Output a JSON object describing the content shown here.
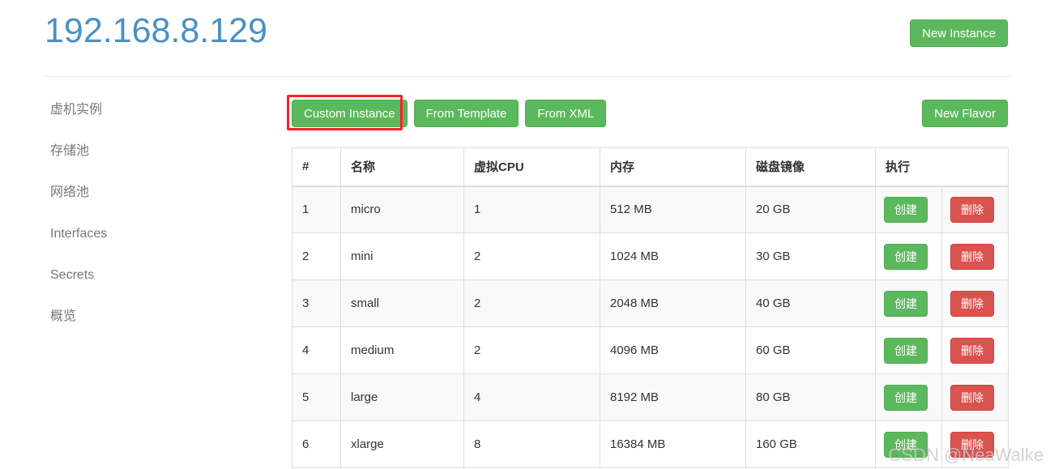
{
  "header": {
    "title": "192.168.8.129",
    "title_color": "#4a90c4",
    "new_instance_label": "New Instance"
  },
  "sidebar": {
    "items": [
      {
        "label": "虚机实例"
      },
      {
        "label": "存储池"
      },
      {
        "label": "网络池"
      },
      {
        "label": "Interfaces"
      },
      {
        "label": "Secrets"
      },
      {
        "label": "概览"
      }
    ]
  },
  "toolbar": {
    "custom_instance_label": "Custom Instance",
    "from_template_label": "From Template",
    "from_xml_label": "From XML",
    "new_flavor_label": "New Flavor",
    "highlight_color": "#f5222d",
    "highlighted_button": "Custom Instance"
  },
  "table": {
    "columns": [
      "#",
      "名称",
      "虚拟CPU",
      "内存",
      "磁盘镜像",
      "执行"
    ],
    "action_labels": {
      "create": "创建",
      "delete": "删除"
    },
    "action_colors": {
      "create": "#5cb85c",
      "delete": "#d9534f"
    },
    "rows": [
      {
        "idx": "1",
        "name": "micro",
        "cpu": "1",
        "memory": "512 MB",
        "disk": "20 GB",
        "create": "创建",
        "delete": "删除"
      },
      {
        "idx": "2",
        "name": "mini",
        "cpu": "2",
        "memory": "1024 MB",
        "disk": "30 GB",
        "create": "创建",
        "delete": "删除"
      },
      {
        "idx": "3",
        "name": "small",
        "cpu": "2",
        "memory": "2048 MB",
        "disk": "40 GB",
        "create": "创建",
        "delete": "删除"
      },
      {
        "idx": "4",
        "name": "medium",
        "cpu": "2",
        "memory": "4096 MB",
        "disk": "60 GB",
        "create": "创建",
        "delete": "删除"
      },
      {
        "idx": "5",
        "name": "large",
        "cpu": "4",
        "memory": "8192 MB",
        "disk": "80 GB",
        "create": "创建",
        "delete": "删除"
      },
      {
        "idx": "6",
        "name": "xlarge",
        "cpu": "8",
        "memory": "16384 MB",
        "disk": "160 GB",
        "create": "创建",
        "delete": "删除"
      }
    ]
  },
  "watermark": {
    "text": "CSDN @NeaWalke"
  }
}
